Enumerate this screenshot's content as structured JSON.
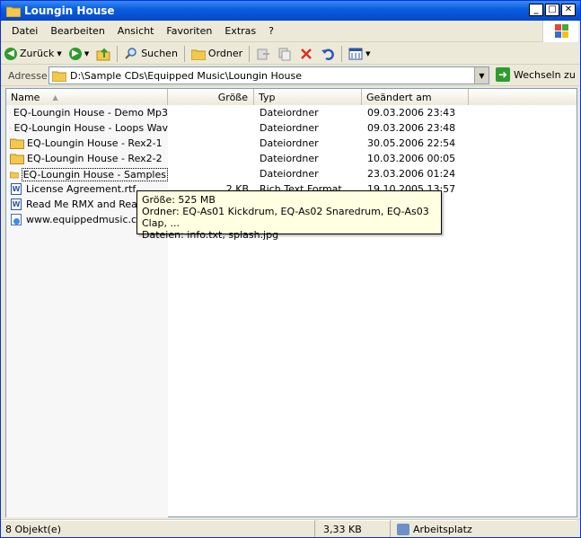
{
  "window": {
    "title": "Loungin House"
  },
  "menubar": {
    "items": [
      "Datei",
      "Bearbeiten",
      "Ansicht",
      "Favoriten",
      "Extras",
      "?"
    ]
  },
  "toolbar": {
    "back_label": "Zurück",
    "search_label": "Suchen",
    "folders_label": "Ordner"
  },
  "address": {
    "label": "Adresse",
    "path": "D:\\Sample CDs\\Equipped Music\\Loungin House",
    "go_label": "Wechseln zu"
  },
  "columns": {
    "name": "Name",
    "size": "Größe",
    "type": "Typ",
    "modified": "Geändert am"
  },
  "files": [
    {
      "icon": "folder-icon",
      "name": "EQ-Loungin House - Demo Mp3",
      "size": "",
      "type": "Dateiordner",
      "modified": "09.03.2006 23:43"
    },
    {
      "icon": "folder-icon",
      "name": "EQ-Loungin House - Loops Wav",
      "size": "",
      "type": "Dateiordner",
      "modified": "09.03.2006 23:48"
    },
    {
      "icon": "folder-icon",
      "name": "EQ-Loungin House - Rex2-1",
      "size": "",
      "type": "Dateiordner",
      "modified": "30.05.2006 22:54"
    },
    {
      "icon": "folder-icon",
      "name": "EQ-Loungin House - Rex2-2",
      "size": "",
      "type": "Dateiordner",
      "modified": "10.03.2006 00:05"
    },
    {
      "icon": "folder-icon",
      "name": "EQ-Loungin House - Samples",
      "size": "",
      "type": "Dateiordner",
      "modified": "23.03.2006 01:24"
    },
    {
      "icon": "word-doc-icon",
      "name": "License Agreement.rtf",
      "size": "2 KB",
      "type": "Rich Text Format",
      "modified": "19.10.2005 13:57"
    },
    {
      "icon": "word-doc-icon",
      "name": "Read Me RMX and Reason",
      "size": "",
      "type": "",
      "modified": ""
    },
    {
      "icon": "internet-shortcut-icon",
      "name": "www.equippedmusic.com",
      "size": "",
      "type": "",
      "modified": ""
    }
  ],
  "tooltip": {
    "size_line": "Größe: 525 MB",
    "folders_line": "Ordner: EQ-As01 Kickdrum, EQ-As02 Snaredrum, EQ-As03 Clap, ...",
    "files_line": "Dateien: info.txt, splash.jpg"
  },
  "statusbar": {
    "count": "8 Objekt(e)",
    "size": "3,33 KB",
    "location": "Arbeitsplatz"
  },
  "colors": {
    "title_bar": "#0a5fe0",
    "folder": "#f2c94c",
    "tooltip_bg": "#ffffe1",
    "delete_red": "#d93025"
  }
}
